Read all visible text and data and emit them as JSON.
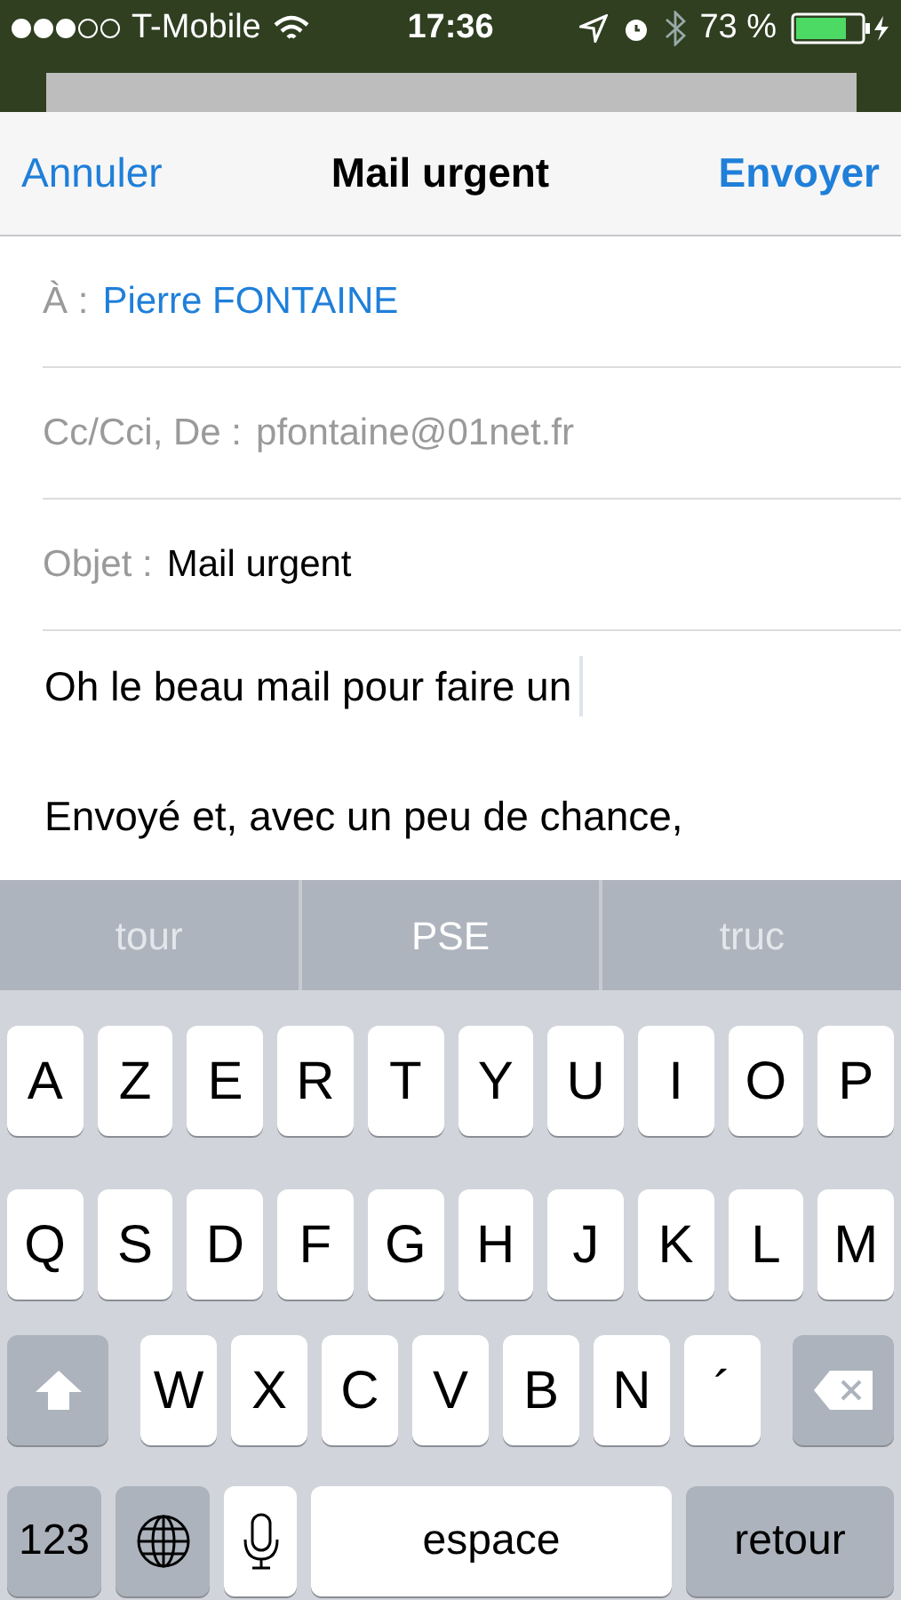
{
  "status_bar": {
    "carrier": "T-Mobile",
    "time": "17:36",
    "battery": "73 %"
  },
  "nav": {
    "cancel": "Annuler",
    "title": "Mail urgent",
    "send": "Envoyer"
  },
  "fields": [
    {
      "label": "À :",
      "value": "Pierre FONTAINE",
      "kind": "recipient"
    },
    {
      "label": "Cc/Cci, De :",
      "value": "pfontaine@01net.fr",
      "kind": "muted"
    },
    {
      "label": "Objet :",
      "value": "Mail urgent",
      "kind": "plain"
    }
  ],
  "body": [
    "Oh le beau mail pour faire un",
    "Envoyé et, avec un peu de chance,"
  ],
  "suggestions": [
    {
      "label": "tour",
      "selected": false
    },
    {
      "label": "PSE",
      "selected": true
    },
    {
      "label": "truc",
      "selected": false
    }
  ],
  "keyboard": [
    [
      {
        "kind": "letter",
        "label": "A"
      },
      {
        "kind": "letter",
        "label": "Z"
      },
      {
        "kind": "letter",
        "label": "E"
      },
      {
        "kind": "letter",
        "label": "R"
      },
      {
        "kind": "letter",
        "label": "T"
      },
      {
        "kind": "letter",
        "label": "Y"
      },
      {
        "kind": "letter",
        "label": "U"
      },
      {
        "kind": "letter",
        "label": "I"
      },
      {
        "kind": "letter",
        "label": "O"
      },
      {
        "kind": "letter",
        "label": "P"
      }
    ],
    [
      {
        "kind": "letter",
        "label": "Q"
      },
      {
        "kind": "letter",
        "label": "S"
      },
      {
        "kind": "letter",
        "label": "D"
      },
      {
        "kind": "letter",
        "label": "F"
      },
      {
        "kind": "letter",
        "label": "G"
      },
      {
        "kind": "letter",
        "label": "H"
      },
      {
        "kind": "letter",
        "label": "J"
      },
      {
        "kind": "letter",
        "label": "K"
      },
      {
        "kind": "letter",
        "label": "L"
      },
      {
        "kind": "letter",
        "label": "M"
      }
    ],
    [
      {
        "kind": "shift"
      },
      {
        "kind": "letter",
        "label": "W"
      },
      {
        "kind": "letter",
        "label": "X"
      },
      {
        "kind": "letter",
        "label": "C"
      },
      {
        "kind": "letter",
        "label": "V"
      },
      {
        "kind": "letter",
        "label": "B"
      },
      {
        "kind": "letter",
        "label": "N"
      },
      {
        "kind": "letter",
        "label": "´"
      },
      {
        "kind": "delete"
      }
    ],
    [
      {
        "kind": "numbers",
        "label": "123"
      },
      {
        "kind": "globe"
      },
      {
        "kind": "mic"
      },
      {
        "kind": "space",
        "label": "espace"
      },
      {
        "kind": "return",
        "label": "retour"
      }
    ]
  ]
}
